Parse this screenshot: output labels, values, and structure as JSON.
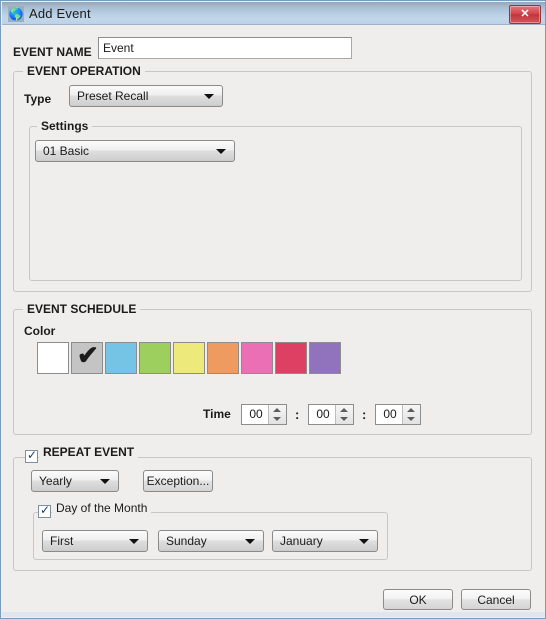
{
  "window": {
    "title": "Add Event",
    "app_icon": "globe-icon",
    "close_label": "✕",
    "close_icon": "close-icon"
  },
  "event_name": {
    "label": "EVENT NAME",
    "value": "Event",
    "placeholder": ""
  },
  "event_operation": {
    "group_title": "EVENT OPERATION",
    "type_label": "Type",
    "type_value": "Preset Recall",
    "settings": {
      "group_title": "Settings",
      "preset_value": "01 Basic"
    }
  },
  "event_schedule": {
    "group_title": "EVENT SCHEDULE",
    "color_label": "Color",
    "selected_index": 1,
    "check_glyph": "✔",
    "swatches": [
      {
        "name": "white",
        "hex": "#ffffff"
      },
      {
        "name": "gray",
        "hex": "#c4c4c4"
      },
      {
        "name": "blue",
        "hex": "#75c4e6"
      },
      {
        "name": "green",
        "hex": "#9ccf5e"
      },
      {
        "name": "yellow",
        "hex": "#ede97a"
      },
      {
        "name": "orange",
        "hex": "#ef9a5e"
      },
      {
        "name": "pink",
        "hex": "#ea6fb4"
      },
      {
        "name": "red",
        "hex": "#dd4063"
      },
      {
        "name": "purple",
        "hex": "#9172bd"
      }
    ],
    "time_label": "Time",
    "time_separator": ":",
    "time_hours": "00",
    "time_minutes": "00",
    "time_seconds": "00"
  },
  "repeat_event": {
    "group_title": "REPEAT EVENT",
    "enabled": true,
    "frequency_value": "Yearly",
    "exception_label": "Exception...",
    "day_of_month": {
      "group_title": "Day of the Month",
      "enabled": true,
      "ordinal_value": "First",
      "weekday_value": "Sunday",
      "month_value": "January"
    }
  },
  "footer": {
    "ok_label": "OK",
    "cancel_label": "Cancel"
  }
}
